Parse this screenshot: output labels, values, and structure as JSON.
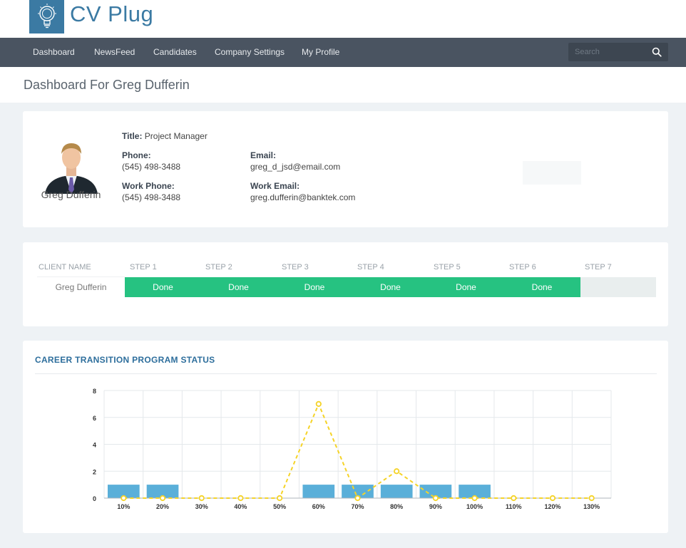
{
  "brand": {
    "name": "CV Plug"
  },
  "nav": {
    "items": [
      {
        "label": "Dashboard"
      },
      {
        "label": "NewsFeed"
      },
      {
        "label": "Candidates"
      },
      {
        "label": "Company Settings"
      },
      {
        "label": "My Profile"
      }
    ],
    "search_placeholder": "Search"
  },
  "page": {
    "title": "Dashboard For Greg Dufferin"
  },
  "profile": {
    "name": "Greg Dufferin",
    "title_label": "Title:",
    "title_value": "Project Manager",
    "phone_label": "Phone:",
    "phone_value": "(545) 498-3488",
    "work_phone_label": "Work Phone:",
    "work_phone_value": "(545) 498-3488",
    "email_label": "Email:",
    "email_value": "greg_d_jsd@email.com",
    "work_email_label": "Work Email:",
    "work_email_value": "greg.dufferin@banktek.com"
  },
  "steps": {
    "headers": [
      "CLIENT NAME",
      "STEP 1",
      "STEP 2",
      "STEP 3",
      "STEP 4",
      "STEP 5",
      "STEP 6",
      "STEP 7"
    ],
    "client": "Greg Dufferin",
    "cells": [
      "Done",
      "Done",
      "Done",
      "Done",
      "Done",
      "Done",
      ""
    ],
    "done_color": "#26c281"
  },
  "chart_title": "CAREER TRANSITION PROGRAM STATUS",
  "chart_data": {
    "type": "bar",
    "categories": [
      "10%",
      "20%",
      "30%",
      "40%",
      "50%",
      "60%",
      "70%",
      "80%",
      "90%",
      "100%",
      "110%",
      "120%",
      "130%"
    ],
    "series": [
      {
        "type": "bar",
        "color": "#5aafd9",
        "values": [
          1,
          1,
          0,
          0,
          0,
          1,
          1,
          1,
          1,
          1,
          0,
          0,
          0
        ]
      },
      {
        "type": "line",
        "style": "dashed",
        "color": "#f5d327",
        "values": [
          0,
          0,
          0,
          0,
          0,
          7,
          0,
          2,
          0,
          0,
          0,
          0,
          0
        ]
      }
    ],
    "ylim": [
      0,
      8
    ],
    "yticks": [
      "0",
      "2",
      "4",
      "6",
      "8"
    ],
    "grid": true
  }
}
